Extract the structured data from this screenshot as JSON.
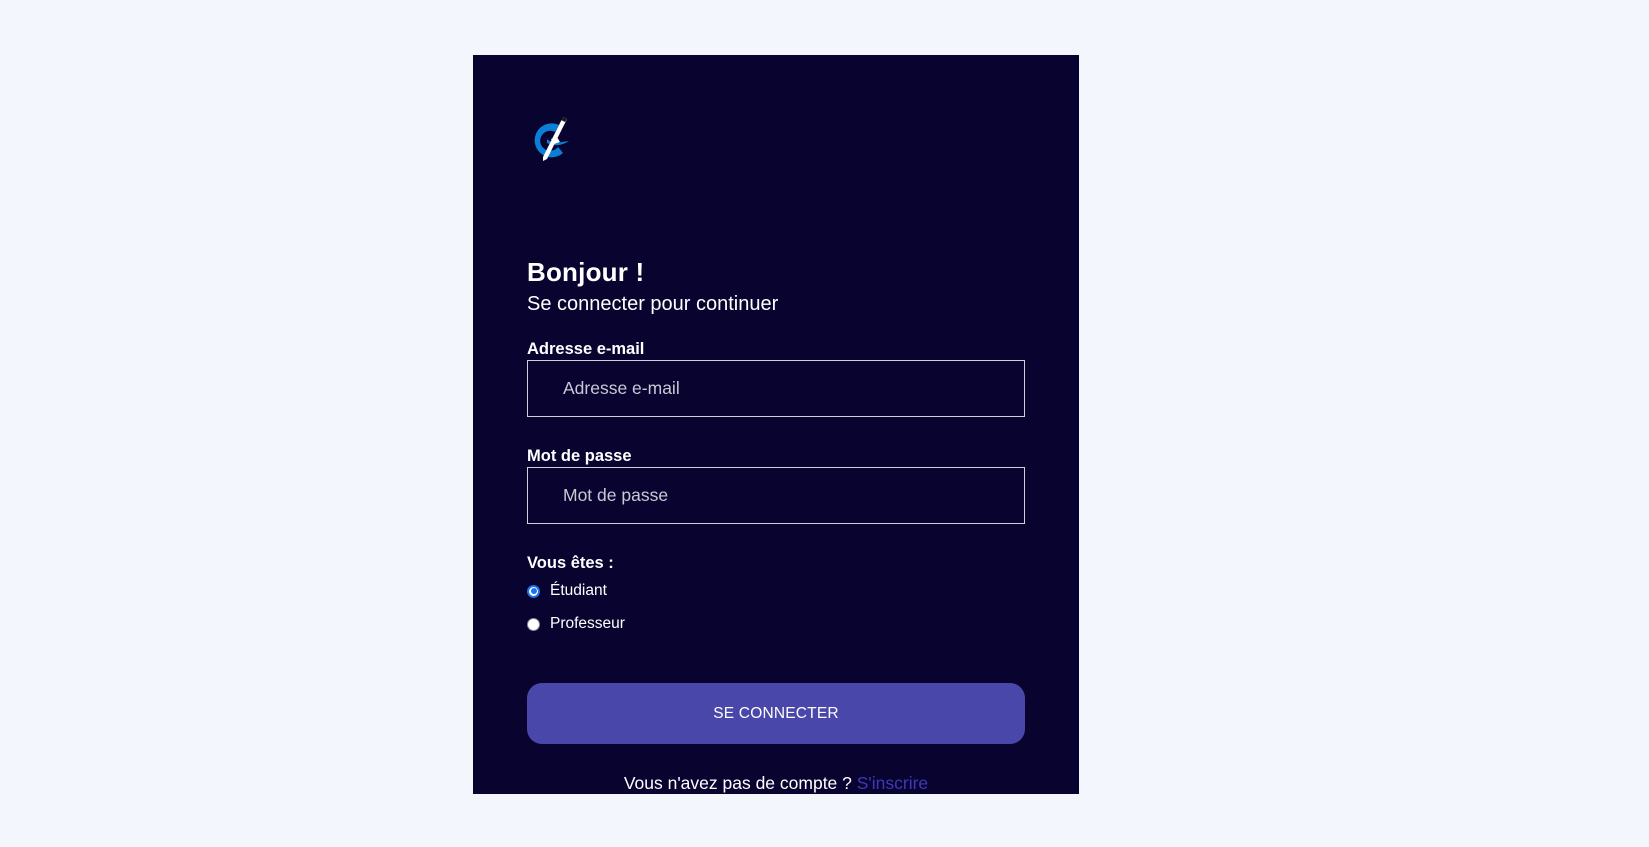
{
  "greeting": "Bonjour !",
  "subtitle": "Se connecter pour continuer",
  "email": {
    "label": "Adresse e-mail",
    "placeholder": "Adresse e-mail"
  },
  "password": {
    "label": "Mot de passe",
    "placeholder": "Mot de passe"
  },
  "role": {
    "label": "Vous êtes :",
    "options": [
      "Étudiant",
      "Professeur"
    ],
    "selected": "Étudiant"
  },
  "submit_label": "SE CONNECTER",
  "footer": {
    "text": "Vous n'avez pas de compte ? ",
    "link_label": "S'inscrire"
  },
  "logo_icon": "compass-pen-logo-icon",
  "colors": {
    "page_background": "#f4f6fe",
    "card_background": "#090330",
    "button": "#4a47ab",
    "link": "#3d3ab8",
    "logo_blue": "#0a7fd8"
  }
}
